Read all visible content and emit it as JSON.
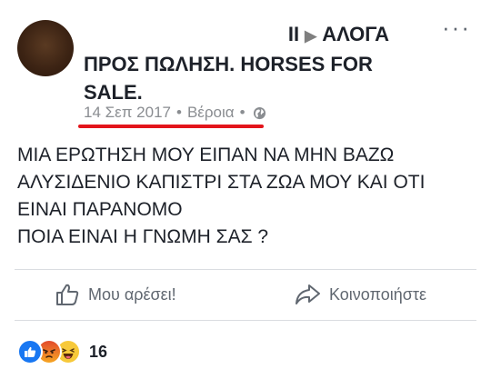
{
  "post": {
    "author_line1": "ΑΛΟΓΑ",
    "author_prefix": "II",
    "group_name": "ΠΡΟΣ ΠΩΛΗΣΗ. HORSES FOR SALE.",
    "date": "14 Σεπ 2017",
    "location": "Βέροια",
    "separator": "•",
    "more_label": "···",
    "body_lines": [
      "ΜΙΑ ΕΡΩΤΗΣΗ ΜΟΥ ΕΙΠΑΝ ΝΑ ΜΗΝ ΒΑΖΩ",
      "ΑΛΥΣΙΔΕΝΙΟ ΚΑΠΙΣΤΡΙ ΣΤΑ ΖΩΑ ΜΟΥ ΚΑΙ ΟΤΙ",
      "ΕΙΝΑΙ ΠΑΡΑΝΟΜΟ",
      "ΠΟΙΑ ΕΙΝΑΙ Η ΓΝΩΜΗ ΣΑΣ ?"
    ]
  },
  "actions": {
    "like_label": "Μου αρέσει!",
    "share_label": "Κοινοποιήστε"
  },
  "reactions": {
    "icons": [
      "like-icon",
      "angry-icon",
      "haha-icon"
    ],
    "count": "16"
  },
  "colors": {
    "underline": "#e3151b",
    "like_blue": "#1877f2",
    "muted": "#606770"
  }
}
